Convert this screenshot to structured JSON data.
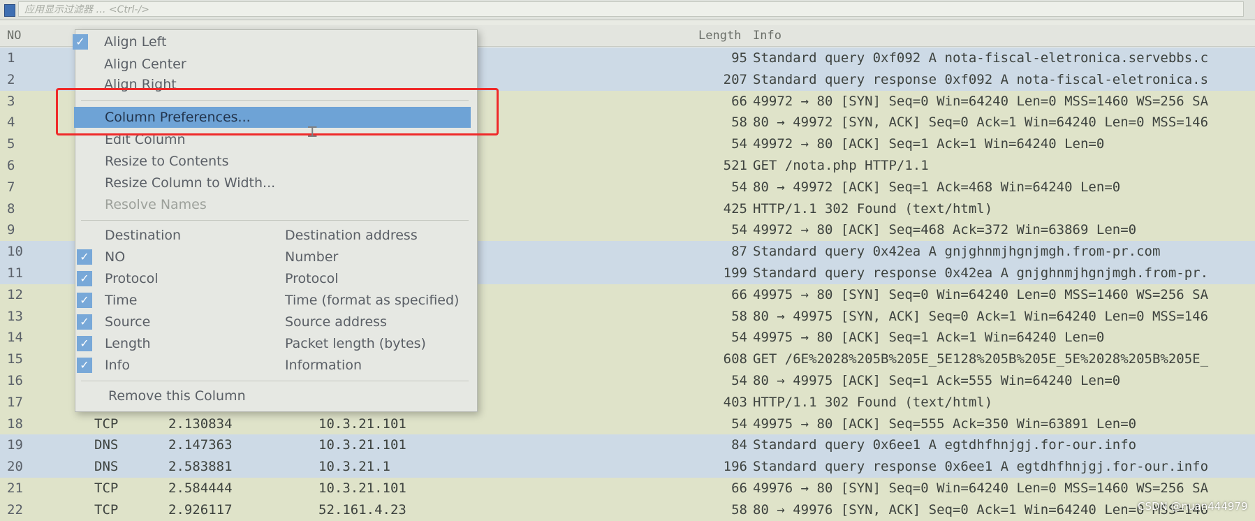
{
  "filter_bar": {
    "placeholder": "应用显示过滤器 … <Ctrl-/>"
  },
  "columns": {
    "no": "NO",
    "length": "Length",
    "info": "Info"
  },
  "packets": [
    {
      "no": "1",
      "proto": "",
      "time": "",
      "src": "",
      "len": "95",
      "info": "Standard query 0xf092 A nota-fiscal-eletronica.servebbs.c",
      "type": "dns"
    },
    {
      "no": "2",
      "proto": "",
      "time": "",
      "src": "",
      "len": "207",
      "info": "Standard query response 0xf092 A nota-fiscal-eletronica.s",
      "type": "dns"
    },
    {
      "no": "3",
      "proto": "",
      "time": "",
      "src": "",
      "len": "66",
      "info": "49972 → 80 [SYN] Seq=0 Win=64240 Len=0 MSS=1460 WS=256 SA",
      "type": "tcp"
    },
    {
      "no": "4",
      "proto": "",
      "time": "",
      "src": "",
      "len": "58",
      "info": "80 → 49972 [SYN, ACK] Seq=0 Ack=1 Win=64240 Len=0 MSS=146",
      "type": "tcp"
    },
    {
      "no": "5",
      "proto": "",
      "time": "",
      "src": "",
      "len": "54",
      "info": "49972 → 80 [ACK] Seq=1 Ack=1 Win=64240 Len=0",
      "type": "tcp"
    },
    {
      "no": "6",
      "proto": "",
      "time": "",
      "src": "",
      "len": "521",
      "info": "GET /nota.php HTTP/1.1",
      "type": "http"
    },
    {
      "no": "7",
      "proto": "",
      "time": "",
      "src": "",
      "len": "54",
      "info": "80 → 49972 [ACK] Seq=1 Ack=468 Win=64240 Len=0",
      "type": "tcp"
    },
    {
      "no": "8",
      "proto": "",
      "time": "",
      "src": "",
      "len": "425",
      "info": "HTTP/1.1 302 Found  (text/html)",
      "type": "http"
    },
    {
      "no": "9",
      "proto": "",
      "time": "",
      "src": "",
      "len": "54",
      "info": "49972 → 80 [ACK] Seq=468 Ack=372 Win=63869 Len=0",
      "type": "tcp"
    },
    {
      "no": "10",
      "proto": "",
      "time": "",
      "src": "",
      "len": "87",
      "info": "Standard query 0x42ea A gnjghnmjhgnjmgh.from-pr.com",
      "type": "dns"
    },
    {
      "no": "11",
      "proto": "",
      "time": "",
      "src": "",
      "len": "199",
      "info": "Standard query response 0x42ea A gnjghnmjhgnjmgh.from-pr.",
      "type": "dns"
    },
    {
      "no": "12",
      "proto": "",
      "time": "",
      "src": "",
      "len": "66",
      "info": "49975 → 80 [SYN] Seq=0 Win=64240 Len=0 MSS=1460 WS=256 SA",
      "type": "tcp"
    },
    {
      "no": "13",
      "proto": "",
      "time": "",
      "src": "",
      "len": "58",
      "info": "80 → 49975 [SYN, ACK] Seq=0 Ack=1 Win=64240 Len=0 MSS=146",
      "type": "tcp"
    },
    {
      "no": "14",
      "proto": "",
      "time": "",
      "src": "",
      "len": "54",
      "info": "49975 → 80 [ACK] Seq=1 Ack=1 Win=64240 Len=0",
      "type": "tcp"
    },
    {
      "no": "15",
      "proto": "",
      "time": "",
      "src": "",
      "len": "608",
      "info": "GET /6E%2028%205B%205E_5E128%205B%205E_5E%2028%205B%205E_",
      "type": "http"
    },
    {
      "no": "16",
      "proto": "",
      "time": "",
      "src": "",
      "len": "54",
      "info": "80 → 49975 [ACK] Seq=1 Ack=555 Win=64240 Len=0",
      "type": "tcp"
    },
    {
      "no": "17",
      "proto": "",
      "time": "",
      "src": "",
      "len": "403",
      "info": "HTTP/1.1 302 Found  (text/html)",
      "type": "http"
    },
    {
      "no": "18",
      "proto": "TCP",
      "time": "2.130834",
      "src": "10.3.21.101",
      "len": "54",
      "info": "49975 → 80 [ACK] Seq=555 Ack=350 Win=63891 Len=0",
      "type": "tcp"
    },
    {
      "no": "19",
      "proto": "DNS",
      "time": "2.147363",
      "src": "10.3.21.101",
      "len": "84",
      "info": "Standard query 0x6ee1 A egtdhfhnjgj.for-our.info",
      "type": "dns"
    },
    {
      "no": "20",
      "proto": "DNS",
      "time": "2.583881",
      "src": "10.3.21.1",
      "len": "196",
      "info": "Standard query response 0x6ee1 A egtdhfhnjgj.for-our.info",
      "type": "dns"
    },
    {
      "no": "21",
      "proto": "TCP",
      "time": "2.584444",
      "src": "10.3.21.101",
      "len": "66",
      "info": "49976 → 80 [SYN] Seq=0 Win=64240 Len=0 MSS=1460 WS=256 SA",
      "type": "tcp"
    },
    {
      "no": "22",
      "proto": "TCP",
      "time": "2.926117",
      "src": "52.161.4.23",
      "len": "58",
      "info": "80 → 49976 [SYN, ACK] Seq=0 Ack=1 Win=64240 Len=0 MSS=146",
      "type": "tcp"
    }
  ],
  "menu": {
    "align_left": "Align Left",
    "align_center": "Align Center",
    "align_right": "Align Right",
    "column_preferences": "Column Preferences...",
    "edit_column": "Edit Column",
    "resize_to_contents": "Resize to Contents",
    "resize_column_to_width": "Resize Column to Width...",
    "resolve_names": "Resolve Names",
    "columns_header_name": "Destination",
    "columns_header_desc": "Destination address",
    "column_toggles": [
      {
        "name": "NO",
        "desc": "Number"
      },
      {
        "name": "Protocol",
        "desc": "Protocol"
      },
      {
        "name": "Time",
        "desc": "Time (format as specified)"
      },
      {
        "name": "Source",
        "desc": "Source address"
      },
      {
        "name": "Length",
        "desc": "Packet length (bytes)"
      },
      {
        "name": "Info",
        "desc": "Information"
      }
    ],
    "remove_column": "Remove this Column"
  },
  "watermark": "CSDN @nuan444979",
  "colors": {
    "dns_row": "#cddae6",
    "tcp_row": "#dfe3c9",
    "highlight": "#ef2a2a",
    "selected_item": "#6ea3d6"
  }
}
